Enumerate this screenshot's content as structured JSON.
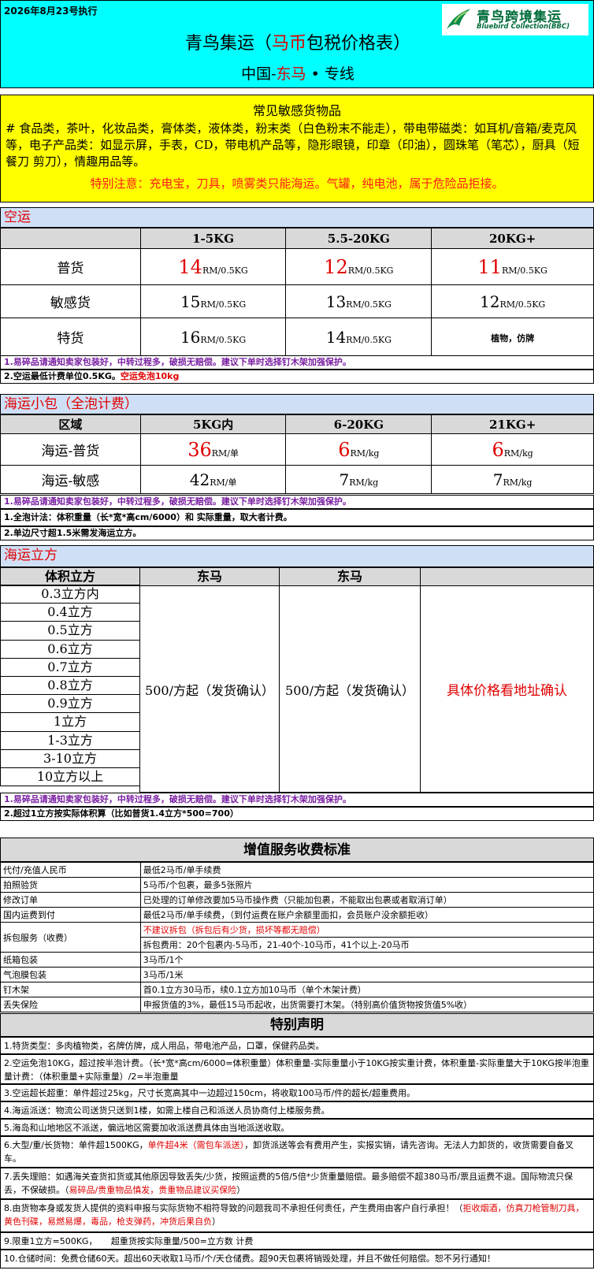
{
  "header": {
    "exec_date": "2026年8月23号执行",
    "title_pre": "青鸟集运（",
    "title_red": "马币",
    "title_post": "包税价格表）",
    "sub_pre": "中国-",
    "sub_red": "东马",
    "sub_post": " • 专线",
    "logo_cn": "青鸟跨境集运",
    "logo_en": "Bluebird Collection(BBC)",
    "brand_color": "#006c3a"
  },
  "sensitive": {
    "title": "常见敏感货物品",
    "body": "# 食品类，茶叶，化妆品类，膏体类，液体类，粉末类（白色粉末不能走），带电带磁类：如耳机/音箱/麦克风等，电子产品类：如显示屏，手表，CD，带电机产品等，隐形眼镜，印章（印油），圆珠笔（笔芯），厨具（短餐刀 剪刀），情趣用品等。",
    "note": "特别注意：充电宝，刀具，喷雾类只能海运。气罐，纯电池，属于危险品拒接。"
  },
  "air": {
    "title": "空运",
    "headers": [
      "",
      "1-5KG",
      "5.5-20KG",
      "20KG+"
    ],
    "rows": [
      {
        "label": "普货",
        "cells": [
          {
            "n": "14",
            "u": "RM/0.5KG"
          },
          {
            "n": "12",
            "u": "RM/0.5KG"
          },
          {
            "n": "11",
            "u": "RM/0.5KG"
          }
        ]
      },
      {
        "label": "敏感货",
        "cells": [
          {
            "n": "15",
            "u": "RM/0.5KG"
          },
          {
            "n": "13",
            "u": "RM/0.5KG"
          },
          {
            "n": "12",
            "u": "RM/0.5KG"
          }
        ]
      },
      {
        "label": "特货",
        "cells": [
          {
            "n": "16",
            "u": "RM/0.5KG"
          },
          {
            "n": "14",
            "u": "RM/0.5KG"
          },
          {
            "n": "",
            "u": "植物，仿牌"
          }
        ]
      }
    ],
    "note1": "1.易碎品请通知卖家包装好，中转过程多，破损无赔偿。建议下单时选择钉木架加强保护。",
    "note2_pre": "2.空运最低计费单位0.5KG。",
    "note2_red": "空运免泡10kg"
  },
  "sea_small": {
    "title": "海运小包（全泡计费）",
    "headers": [
      "区域",
      "5KG内",
      "6-20KG",
      "21KG+"
    ],
    "rows": [
      {
        "label": "海运-普货",
        "cells": [
          {
            "n": "36",
            "u": "RM/单"
          },
          {
            "n": "6",
            "u": "RM/kg"
          },
          {
            "n": "6",
            "u": "RM/kg"
          }
        ]
      },
      {
        "label": "海运-敏感",
        "cells": [
          {
            "n": "42",
            "u": "RM/单"
          },
          {
            "n": "7",
            "u": "RM/kg"
          },
          {
            "n": "7",
            "u": "RM/kg"
          }
        ]
      }
    ],
    "note1": "1.易碎品请通知卖家包装好，中转过程多，破损无赔偿。建议下单时选择钉木架加强保护。",
    "note2": "1.全泡计法：体积重量（长*宽*高cm/6000）和 实际重量，取大者计费。",
    "note3": "2.单边尺寸超1.5米需发海运立方。"
  },
  "sea_cube": {
    "title": "海运立方",
    "headers": [
      "体积立方",
      "东马",
      "东马",
      ""
    ],
    "volumes": [
      "0.3立方内",
      "0.4立方",
      "0.5立方",
      "0.6立方",
      "0.7立方",
      "0.8立方",
      "0.9立方",
      "1立方",
      "1-3立方",
      "3-10立方",
      "10立方以上"
    ],
    "price1": "500/方起（发货确认）",
    "price2": "500/方起（发货确认）",
    "price3": "具体价格看地址确认",
    "note1": "1.易碎品请通知卖家包装好，中转过程多，破损无赔偿。建议下单时选择钉木架加强保护。",
    "note2": "2.超过1立方按实际体积算（比如普货1.4立方*500=700）"
  },
  "services": {
    "title": "增值服务收费标准",
    "rows": [
      {
        "k": "代付/充值人民币",
        "v": "最低2马币/单手续费"
      },
      {
        "k": "拍照验货",
        "v": "5马币/个包裹，最多5张照片"
      },
      {
        "k": "修改订单",
        "v": "已处理的订单修改要加5马币操作费（只能加包裹，不能取出包裹或者取消订单）"
      },
      {
        "k": "国内运费到付",
        "v": "最低2马币/单手续费，（到付运费在账户余额里面扣，会员账户没余额拒收）"
      },
      {
        "k": "拆包服务（收费）",
        "v": "不建议拆包（拆包后有少货，损坏等都无赔偿）",
        "v2": "拆包费用：20个包裹内-5马币，21-40个-10马币，41个以上-20马币"
      },
      {
        "k": "纸箱包装",
        "v": "3马币/1个"
      },
      {
        "k": "气泡膜包装",
        "v": "3马币/1米"
      },
      {
        "k": "钉木架",
        "v": "首0.1立方30马币，续0.1立方加10马币（单个木架计费）"
      },
      {
        "k": "丢失保险",
        "v": "申报货值的3%，最低15马币起收，出货需要打木架。（特别高价值货物按货值5%收）"
      }
    ]
  },
  "special": {
    "title": "特别声明",
    "items": [
      {
        "t": "1.特货类型：多肉植物类，名牌仿牌，成人用品，带电池产品，口罩，保健药品类。"
      },
      {
        "t": "2.空运免泡10KG，超过按半泡计费。（长*宽*高cm/6000=体积重量）体积重量-实际重量小于10KG按实重计费，体积重量-实际重量大于10KG按半泡重量计费：（体积重量+实际重量）/2=半泡重量"
      },
      {
        "t": "3.空运超长超重：单件超过25kg，尺寸长宽高其中一边超过150cm，将收取100马币/件的超长/超重费用。"
      },
      {
        "t": "4.海运派送：物流公司送货只送到1楼，如需上楼自己和派送人员协商付上楼服务费。"
      },
      {
        "t": "5.海岛和山地地区不派送，偏远地区需要加收派送费具体由当地派送收取。"
      },
      {
        "t": "6.大型/重/长货物：单件超1500KG，",
        "r": "单件超4米（需包车派送）",
        "t2": "，卸货派送等会有费用产生，实报实销，请先咨询。无法人力卸货的，收货需要自备叉车。"
      },
      {
        "t": "7.丢失理赔：如遇海关查货扣货或其他原因导致丢失/少货，按照运费的5倍/5倍*少货重量赔偿。最多赔偿不超380马币/票且运费不退。国际物流只保丢，不保破损。（",
        "r": "易碎品/贵重物品慎发，贵重物品建议买保险",
        "t2": "）"
      },
      {
        "t": "8.由货物本身或发货人提供的资料申报与实际货物不相符导致的问题我司不承担任何责任，产生费用由客户自行承担！（",
        "r": "拒收烟酒，仿真刀枪管制刀具，黄色刊碟，易燃易爆，毒品，枪支弹药，冲货后果自负",
        "t2": "）"
      },
      {
        "t": "9.限重1立方=500KG，     超重货按实际重量/500=立方数 计费"
      },
      {
        "t": "10.仓储时间：免费仓储60天。超出60天收取1马币/个/天仓储费。超90天包裹将销毁处理，并且不做任何赔偿。恕不另行通知！"
      }
    ]
  }
}
